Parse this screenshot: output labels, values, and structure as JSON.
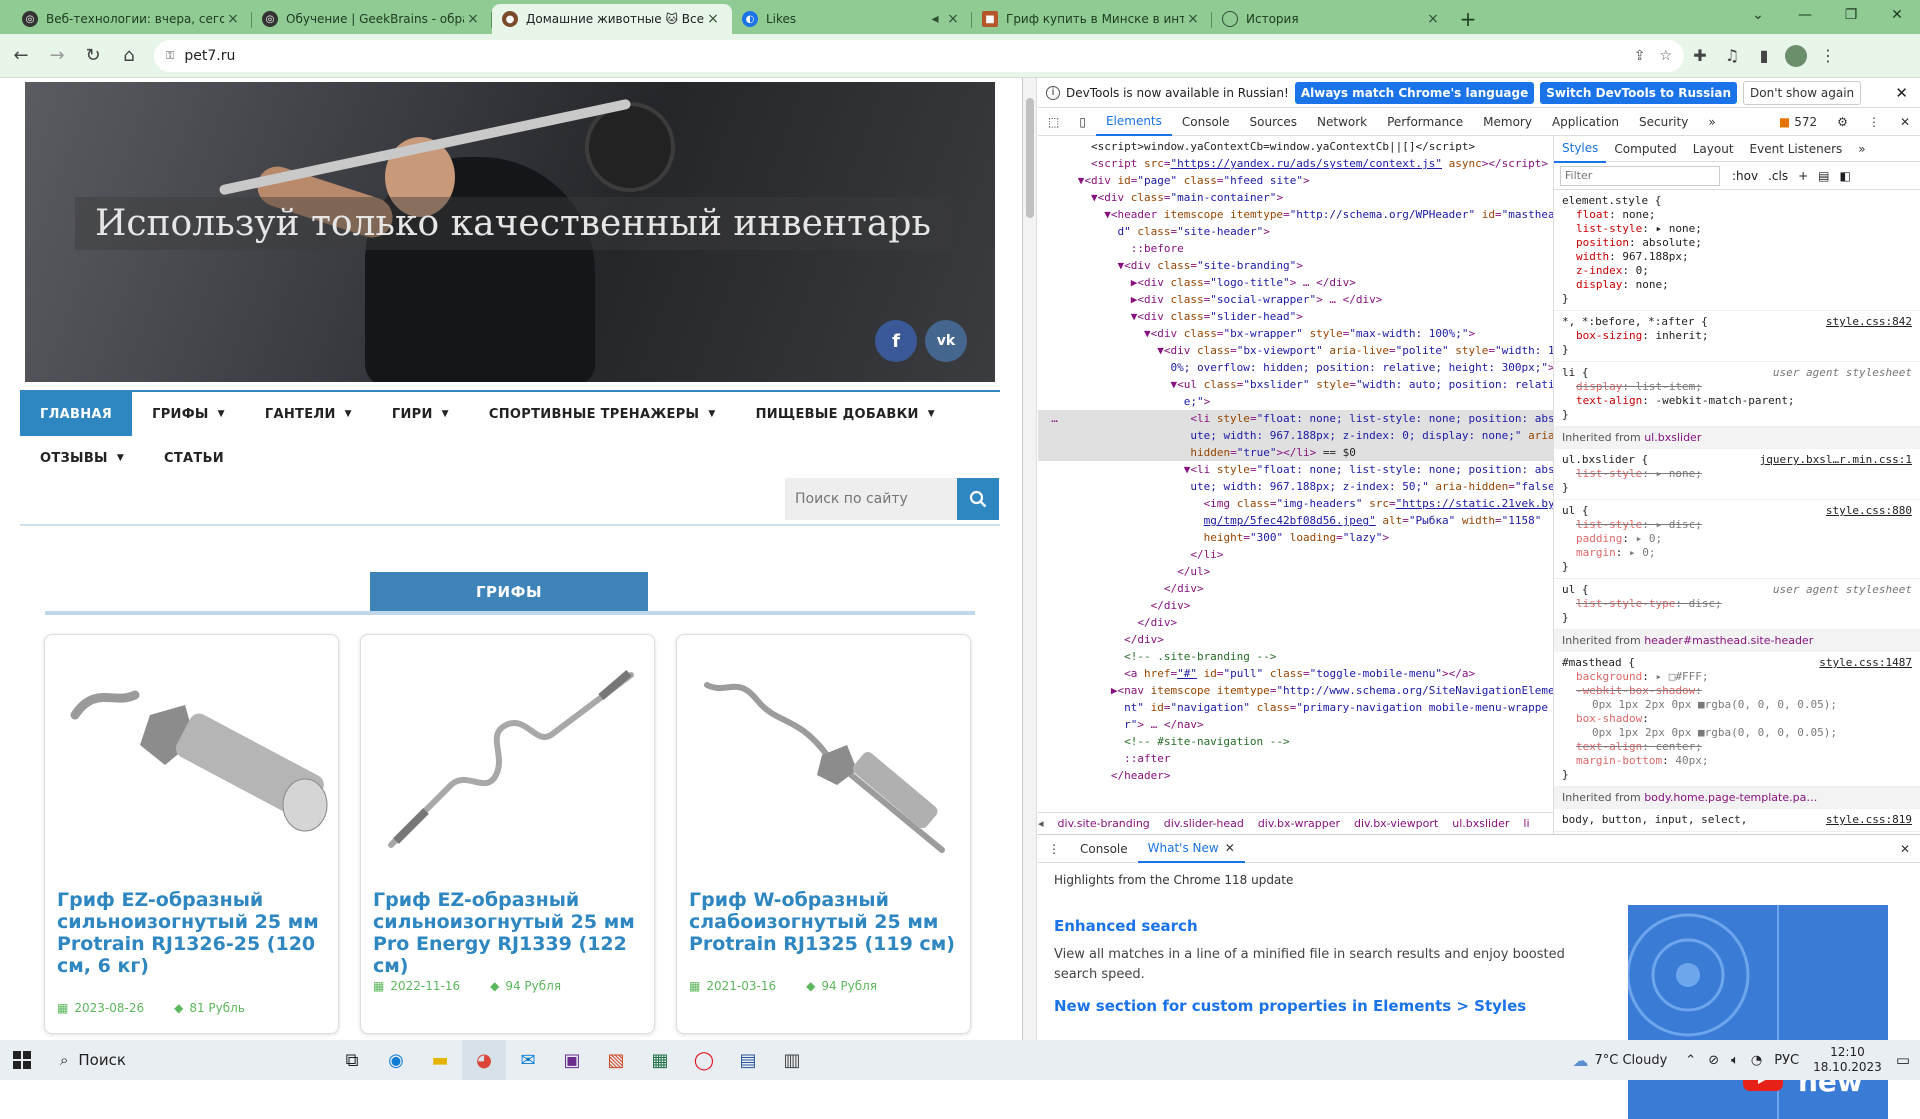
{
  "browser": {
    "tabs": [
      {
        "title": "Веб-технологии: вчера, сегодн",
        "active": false,
        "icon": "openai-icon"
      },
      {
        "title": "Обучение | GeekBrains - образ",
        "active": false,
        "icon": "openai-icon"
      },
      {
        "title": "Домашние животные 🐱 Все п",
        "active": true,
        "icon": "paw-icon"
      },
      {
        "title": "Likes",
        "active": false,
        "icon": "likes-icon"
      },
      {
        "title": "Гриф купить в Минске в интер",
        "active": false,
        "icon": "shop-icon"
      },
      {
        "title": "История",
        "active": false,
        "icon": "history-icon"
      }
    ],
    "url": "pet7.ru"
  },
  "page": {
    "hero_caption": "Используй только качественный инвентарь",
    "social": [
      {
        "name": "facebook",
        "label": "f"
      },
      {
        "name": "vk",
        "label": "vk"
      }
    ],
    "menu": [
      {
        "label": "ГЛАВНАЯ",
        "active": true,
        "dropdown": false
      },
      {
        "label": "ГРИФЫ",
        "active": false,
        "dropdown": true
      },
      {
        "label": "ГАНТЕЛИ",
        "active": false,
        "dropdown": true
      },
      {
        "label": "ГИРИ",
        "active": false,
        "dropdown": true
      },
      {
        "label": "СПОРТИВНЫЕ ТРЕНАЖЕРЫ",
        "active": false,
        "dropdown": true
      },
      {
        "label": "ПИЩЕВЫЕ ДОБАВКИ",
        "active": false,
        "dropdown": true
      },
      {
        "label": "ОТЗЫВЫ",
        "active": false,
        "dropdown": true
      },
      {
        "label": "СТАТЬИ",
        "active": false,
        "dropdown": false
      }
    ],
    "search_placeholder": "Поиск по сайту",
    "section_title": "ГРИФЫ",
    "products": [
      {
        "title": "Гриф EZ-образный сильноизогнутый 25 мм Protrain RJ1326-25 (120 см, 6 кг)",
        "date": "2023-08-26",
        "price": "81 Рубль"
      },
      {
        "title": "Гриф EZ-образный сильноизогнутый 25 мм Pro Energy RJ1339 (122 см)",
        "date": "2022-11-16",
        "price": "94 Рубля"
      },
      {
        "title": "Гриф W-образный слабоизогнутый 25 мм Protrain RJ1325 (119 см)",
        "date": "2021-03-16",
        "price": "94 Рубля"
      }
    ]
  },
  "devtools": {
    "info_text": "DevTools is now available in Russian!",
    "info_buttons": [
      "Always match Chrome's language",
      "Switch DevTools to Russian",
      "Don't show again"
    ],
    "tabs": [
      "Elements",
      "Console",
      "Sources",
      "Network",
      "Performance",
      "Memory",
      "Application",
      "Security"
    ],
    "issues_count": "572",
    "styles_tabs": [
      "Styles",
      "Computed",
      "Layout",
      "Event Listeners"
    ],
    "filter_placeholder": "Filter",
    "filter_buttons": [
      ":hov",
      ".cls"
    ],
    "breadcrumbs": [
      "div.site-branding",
      "div.slider-head",
      "div.bx-wrapper",
      "div.bx-viewport",
      "ul.bxslider",
      "li"
    ],
    "drawer_tabs": [
      "Console",
      "What's New"
    ],
    "whats_new": {
      "subtitle": "Highlights from the Chrome 118 update",
      "h1": "Enhanced search",
      "p1": "View all matches in a line of a minified file in search results and enjoy boosted search speed.",
      "h2": "New section for custom properties in Elements > Styles",
      "img_label": "new"
    }
  },
  "taskbar": {
    "search": "Поиск",
    "weather": "7°C  Cloudy",
    "lang": "РУС",
    "time": "12:10",
    "date": "18.10.2023"
  },
  "colors": {
    "accent": "#2f87c2",
    "tabstrip": "#8fcb93",
    "devtools_blue": "#1a73e8",
    "price_green": "#5cb85c"
  }
}
